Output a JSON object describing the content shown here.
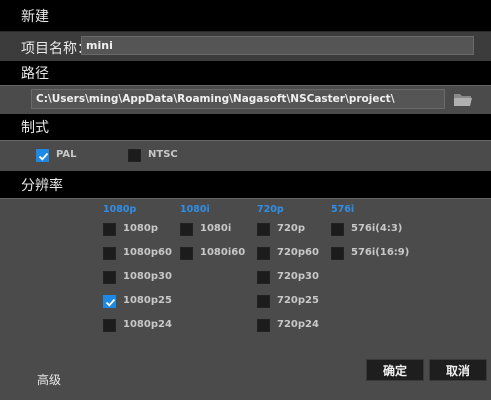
{
  "title": "新建",
  "project": {
    "label": "项目名称：",
    "value": "mini"
  },
  "path": {
    "label": "路径",
    "value": "C:\\Users\\ming\\AppData\\Roaming\\Nagasoft\\NSCaster\\project\\"
  },
  "format": {
    "label": "制式",
    "options": [
      {
        "label": "PAL",
        "checked": true
      },
      {
        "label": "NTSC",
        "checked": false
      }
    ]
  },
  "resolution": {
    "label": "分辨率",
    "columns": [
      {
        "header": "1080p",
        "items": [
          {
            "label": "1080p",
            "checked": false
          },
          {
            "label": "1080p60",
            "checked": false
          },
          {
            "label": "1080p30",
            "checked": false
          },
          {
            "label": "1080p25",
            "checked": true
          },
          {
            "label": "1080p24",
            "checked": false
          }
        ]
      },
      {
        "header": "1080i",
        "items": [
          {
            "label": "1080i",
            "checked": false
          },
          {
            "label": "1080i60",
            "checked": false
          }
        ]
      },
      {
        "header": "720p",
        "items": [
          {
            "label": "720p",
            "checked": false
          },
          {
            "label": "720p60",
            "checked": false
          },
          {
            "label": "720p30",
            "checked": false
          },
          {
            "label": "720p25",
            "checked": false
          },
          {
            "label": "720p24",
            "checked": false
          }
        ]
      },
      {
        "header": "576i",
        "items": [
          {
            "label": "576i(4:3)",
            "checked": false
          },
          {
            "label": "576i(16:9)",
            "checked": false
          }
        ]
      }
    ]
  },
  "footer": {
    "advanced": "高级",
    "ok": "确定",
    "cancel": "取消"
  },
  "colors": {
    "accent": "#1e88e5",
    "header_text": "#2f8fe8"
  }
}
